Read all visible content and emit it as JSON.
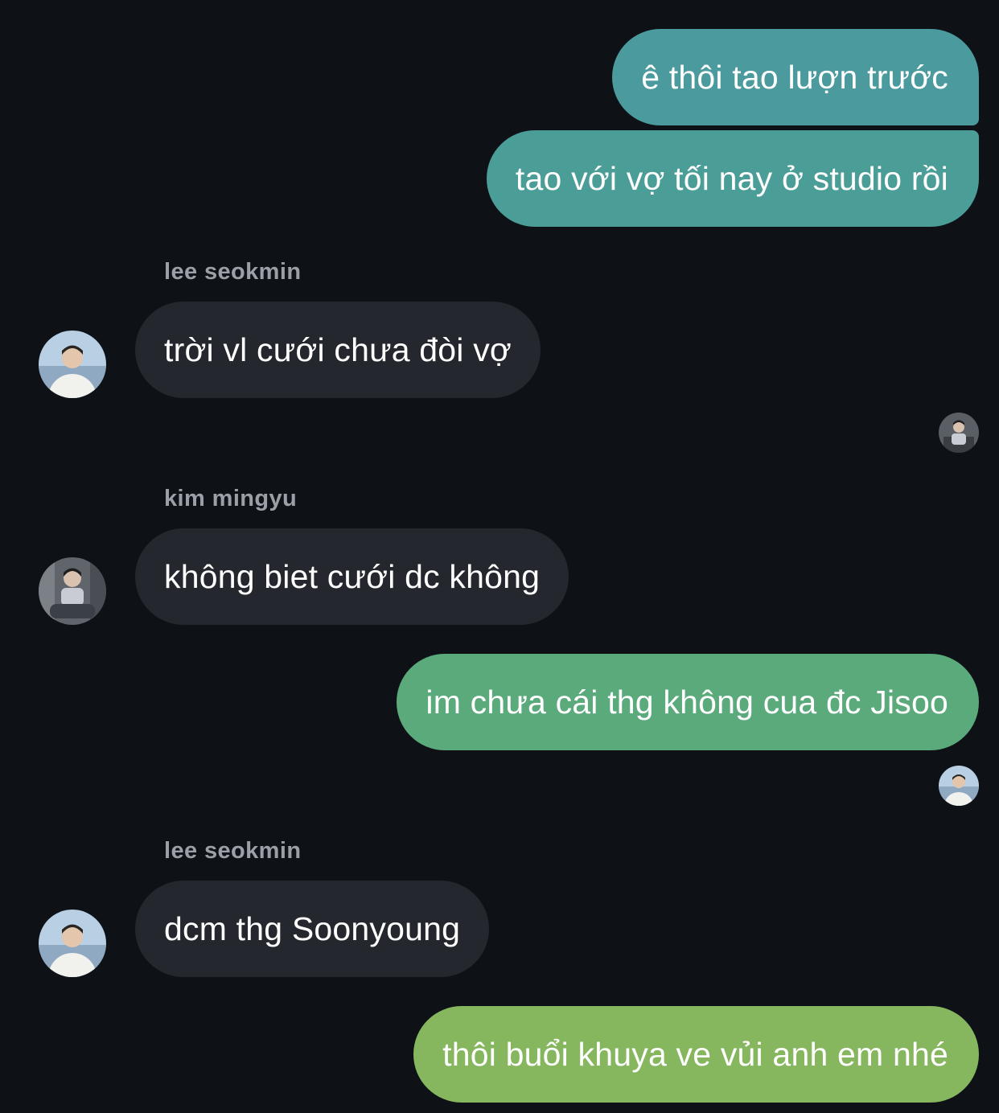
{
  "thread": {
    "messages": [
      {
        "direction": "outgoing",
        "text": "ê thôi tao lượn trước",
        "color": "#4a9a9e"
      },
      {
        "direction": "outgoing",
        "text": "tao với vợ tối nay ở studio rồi",
        "color": "#4b9d98"
      },
      {
        "direction": "incoming",
        "sender": "lee seokmin",
        "text": "trời vl cưới chưa đòi vợ"
      },
      {
        "direction": "incoming",
        "sender": "kim mingyu",
        "text": "không biet cưới dc không"
      },
      {
        "direction": "outgoing",
        "text": "im chưa cái thg không cua đc Jisoo",
        "color": "#5aaa7b"
      },
      {
        "direction": "incoming",
        "sender": "lee seokmin",
        "text": "dcm thg Soonyoung"
      },
      {
        "direction": "outgoing",
        "text": "thôi buổi khuya ve vủi anh em nhé",
        "color": "#86b75e"
      }
    ]
  },
  "icons": {
    "avatar_seokmin": "avatar-photo-seaside",
    "avatar_mingyu": "avatar-photo-sitting",
    "read_receipt": "seen-avatar"
  },
  "colors": {
    "background": "#0e1116",
    "incoming_bubble": "#24272d",
    "sender_name": "#9ba0a8",
    "text": "#ffffff"
  }
}
